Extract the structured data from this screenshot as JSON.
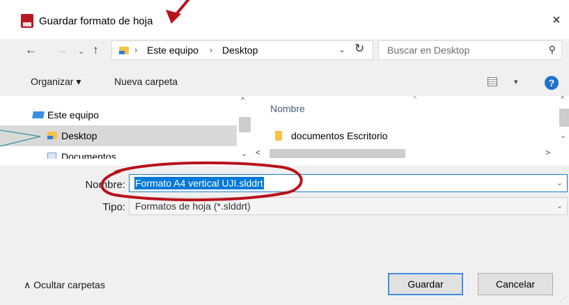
{
  "window": {
    "title": "Guardar formato de hoja",
    "close_label": "×"
  },
  "navigation": {
    "back": "←",
    "forward": "→",
    "recent": "⌄",
    "up": "↑",
    "address_separator": "›",
    "breadcrumbs": [
      "Este equipo",
      "Desktop"
    ],
    "address_dropdown": "⌄",
    "refresh": "↻",
    "search_placeholder": "Buscar en Desktop",
    "search_icon": "⚲"
  },
  "toolbar": {
    "organize_label": "Organizar ▾",
    "new_folder_label": "Nueva carpeta",
    "view_dropdown": "▾",
    "help_label": "?"
  },
  "nav_pane": {
    "items": [
      {
        "label": "Este equipo",
        "icon": "computer-icon"
      },
      {
        "label": "Desktop",
        "icon": "desktop-folder-icon",
        "selected": true
      },
      {
        "label": "Documentos",
        "icon": "documents-icon"
      }
    ]
  },
  "file_list": {
    "column_header": "Nombre",
    "sort_indicator": "^",
    "files": [
      {
        "name": "documentos Escritorio",
        "icon": "folder-icon"
      }
    ]
  },
  "scrollbars": {
    "up": "^",
    "down": "⌄",
    "left": "<",
    "right": ">"
  },
  "form": {
    "name_label": "Nombre:",
    "name_value": "Formato A4 vertical UJI.slddrt",
    "type_label": "Tipo:",
    "type_value": "Formatos de hoja (*.slddrt)",
    "dropdown_caret": "⌄"
  },
  "footer": {
    "hide_folders_label": "∧  Ocultar carpetas",
    "save_label": "Guardar",
    "cancel_label": "Cancelar"
  },
  "colors": {
    "accent": "#0078d7",
    "annotation_red": "#b8121b",
    "annotation_teal": "#3a8fa8"
  }
}
